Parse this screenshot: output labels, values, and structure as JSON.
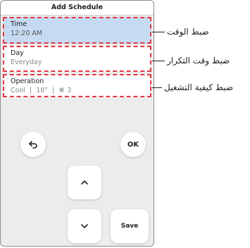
{
  "screen": {
    "title": "Add Schedule"
  },
  "schedule_items": [
    {
      "label": "Time",
      "value": "12:20 AM",
      "annotation": "ضبط الوقت"
    },
    {
      "label": "Day",
      "value": "Everyday",
      "annotation": "ضبط وقت التكرار"
    },
    {
      "label": "Operation",
      "mode": "Cool",
      "temperature": "18°",
      "fan_speed": "3",
      "fan_icon": "fan-icon",
      "annotation": "ضبط كيفية التشغيل"
    }
  ],
  "buttons": {
    "back_icon": "back-arrow-icon",
    "ok_label": "OK",
    "up_icon": "chevron-up-icon",
    "down_icon": "chevron-down-icon",
    "save_label": "Save"
  },
  "colors": {
    "selected_row": "#c6dbf2",
    "highlight_dash": "#e23844",
    "panel_background": "#ececec"
  }
}
